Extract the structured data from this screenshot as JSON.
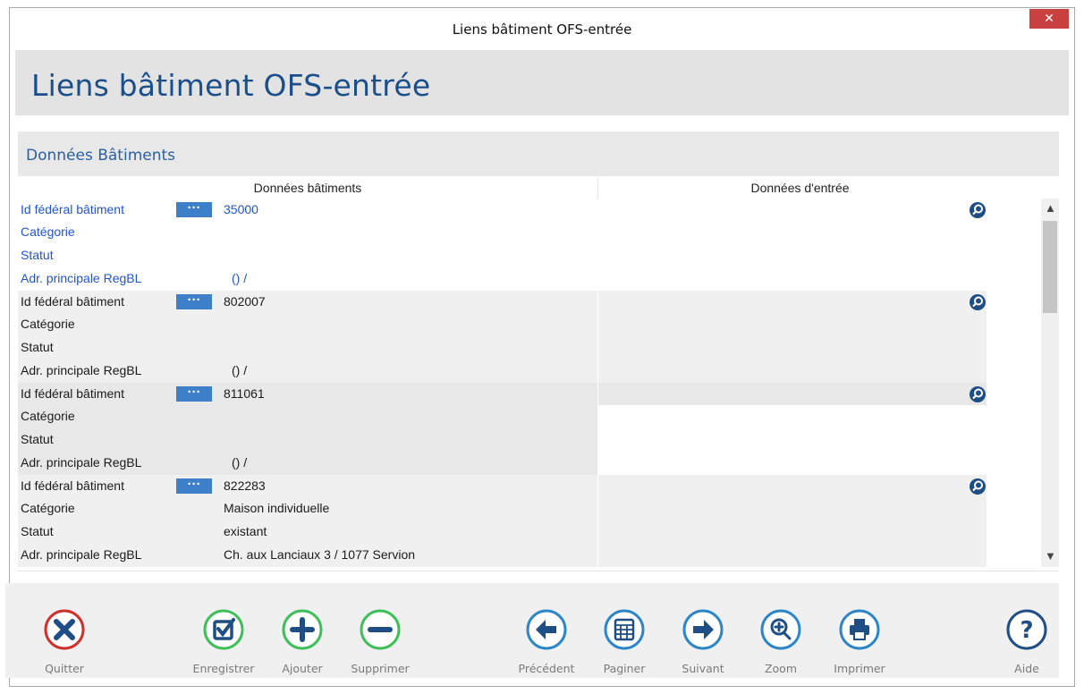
{
  "window": {
    "title": "Liens bâtiment OFS-entrée",
    "close_glyph": "✕"
  },
  "header": {
    "title": "Liens bâtiment OFS-entrée"
  },
  "section": {
    "title": "Données Bâtiments"
  },
  "columns": {
    "left": "Données bâtiments",
    "right": "Données d'entrée"
  },
  "labels": {
    "id": "Id fédéral bâtiment",
    "categorie": "Catégorie",
    "statut": "Statut",
    "adresse": "Adr. principale RegBL",
    "dots": "···"
  },
  "records": [
    {
      "id": "35000",
      "categorie": "",
      "statut": "",
      "adresse": "() /",
      "selected": true
    },
    {
      "id": "802007",
      "categorie": "",
      "statut": "",
      "adresse": "() /",
      "selected": false
    },
    {
      "id": "811061",
      "categorie": "",
      "statut": "",
      "adresse": "() /",
      "selected": false
    },
    {
      "id": "822283",
      "categorie": "Maison individuelle",
      "statut": "existant",
      "adresse": "Ch. aux Lanciaux 3 / 1077 Servion",
      "selected": false
    }
  ],
  "toolbar": {
    "quit": "Quitter",
    "save": "Enregistrer",
    "add": "Ajouter",
    "delete": "Supprimer",
    "prev": "Précédent",
    "paginate": "Paginer",
    "next": "Suivant",
    "zoom": "Zoom",
    "print": "Imprimer",
    "help": "Aide"
  },
  "colors": {
    "selected_text": "#2255cc",
    "normal_text": "#1a1a1a",
    "accent_blue": "#3d7fc8",
    "quit_red": "#d0302c",
    "save_green": "#3fbf5a",
    "nav_blue": "#2d86c8",
    "help_navy": "#1f4e84"
  }
}
